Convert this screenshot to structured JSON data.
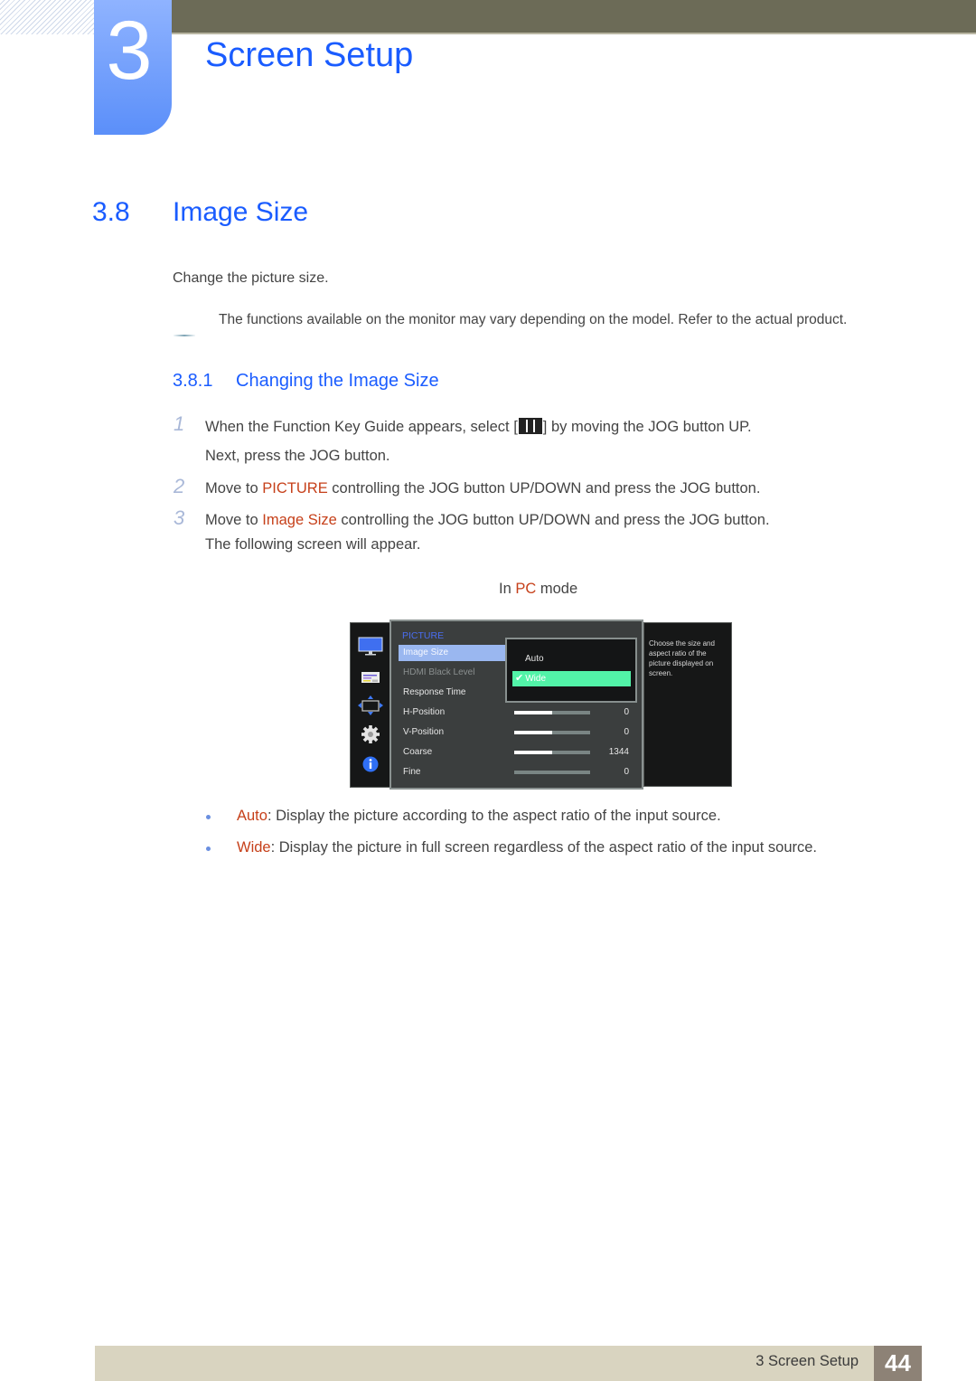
{
  "header": {
    "chapter_number": "3",
    "chapter_title": "Screen Setup"
  },
  "section": {
    "number": "3.8",
    "title": "Image Size",
    "intro": "Change the picture size.",
    "note": "The functions available on the monitor may vary depending on the model. Refer to the actual product."
  },
  "subsection": {
    "number": "3.8.1",
    "title": "Changing the Image Size"
  },
  "steps": [
    {
      "number": "1",
      "line1_before": "When the Function Key Guide appears, select [",
      "icon": "menu-icon",
      "line1_after": "] by moving the JOG button UP.",
      "line2": "Next, press the JOG button."
    },
    {
      "number": "2",
      "before": "Move to ",
      "highlight": "PICTURE",
      "after": " controlling the JOG button UP/DOWN and press the JOG button."
    },
    {
      "number": "3",
      "before": "Move to ",
      "highlight": "Image Size",
      "after": " controlling the JOG button UP/DOWN and press the JOG button.",
      "line2": "The following screen will appear."
    }
  ],
  "mode_caption": {
    "before": "In ",
    "highlight": "PC",
    "after": " mode"
  },
  "osd": {
    "side_icons": [
      "monitor-icon",
      "onscreen-display-icon",
      "position-arrows-icon",
      "gear-icon",
      "info-icon"
    ],
    "heading": "PICTURE",
    "items": [
      {
        "label": "Image Size",
        "state": "selected"
      },
      {
        "label": "HDMI Black Level",
        "state": "dim"
      },
      {
        "label": "Response Time",
        "state": "normal"
      },
      {
        "label": "H-Position",
        "state": "normal",
        "value": "0",
        "bar_fraction": 0.5
      },
      {
        "label": "V-Position",
        "state": "normal",
        "value": "0",
        "bar_fraction": 0.5
      },
      {
        "label": "Coarse",
        "state": "normal",
        "value": "1344",
        "bar_fraction": 0.5
      },
      {
        "label": "Fine",
        "state": "normal",
        "value": "0",
        "bar_fraction": 0.0
      }
    ],
    "popup_options": [
      {
        "label": "Auto",
        "checked": false
      },
      {
        "label": "Wide",
        "checked": true
      }
    ],
    "check_glyph": "✔",
    "help_text": "Choose the size and aspect ratio of the picture displayed on screen."
  },
  "bullets": [
    {
      "term": "Auto",
      "text": ": Display the picture according to the aspect ratio of the input source."
    },
    {
      "term": "Wide",
      "text": ": Display the picture in full screen regardless of the aspect ratio of the input source."
    }
  ],
  "footer": {
    "label": "3 Screen Setup",
    "page": "44"
  },
  "colors": {
    "heading_blue": "#1a5cff",
    "highlight_orange": "#c6401a",
    "osd_selected": "#9ab7f0",
    "osd_checked": "#52f3a8",
    "footer_bg": "#d9d4c0",
    "page_box": "#8d8276",
    "top_bar": "#6c6b57"
  }
}
